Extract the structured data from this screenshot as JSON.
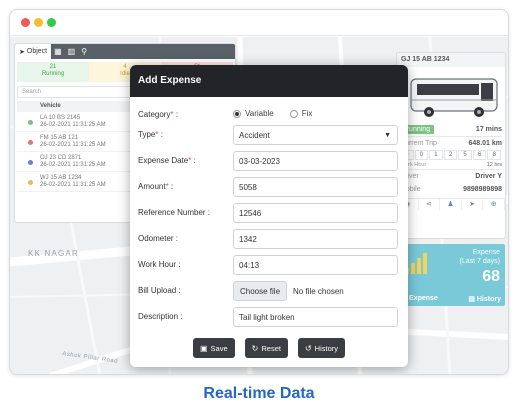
{
  "object_panel": {
    "tabs": {
      "object": "Object"
    },
    "status": [
      {
        "count": "21",
        "label": "Running"
      },
      {
        "count": "4",
        "label": "Idle"
      },
      {
        "count": "",
        "label": "St"
      }
    ],
    "search_placeholder": "Search",
    "column_vehicle": "Vehicle",
    "vehicles": [
      {
        "number": "LA 10 BS 2145",
        "time": "26-02-2021 11:31:25 AM",
        "color": "#7fbf7f"
      },
      {
        "number": "FM 15 AB 121",
        "time": "26-02-2021 11:31:25 AM",
        "color": "#e57373"
      },
      {
        "number": "OJ 23 CD 2871",
        "time": "26-02-2021 11:31:25 AM",
        "color": "#6a7fd6"
      },
      {
        "number": "WJ 15 AB 1234",
        "time": "26-02-2021 11:31:25 AM",
        "color": "#f0b85a"
      }
    ]
  },
  "map": {
    "area_label": "KK NAGAR",
    "road_label": "Ashok Pillar Road"
  },
  "vehicle_card": {
    "title": "GJ 15 AB 1234",
    "status": "Running",
    "duration": "17 mins",
    "current_trip_label": "Current Trip",
    "current_trip_value": "648.01 km",
    "odometer_digits": [
      "0",
      "0",
      "1",
      "2",
      "5",
      "6",
      "8"
    ],
    "work_hour_label": "Work Hour",
    "work_hour_value": "12 hrs",
    "driver_label": "Driver",
    "driver_value": "Driver Y",
    "mobile_label": "Mobile",
    "mobile_value": "9898989898"
  },
  "expense_widget": {
    "title_line1": "Expense",
    "title_line2": "(Last 7 days)",
    "count": "68",
    "add_label": "+ Expense",
    "history_label": "History",
    "bar_color": "#f4d35e"
  },
  "modal": {
    "title": "Add Expense",
    "category_label": "Category",
    "category_options": [
      "Variable",
      "Fix"
    ],
    "category_selected": "Variable",
    "type_label": "Type",
    "type_value": "Accident",
    "expense_date_label": "Expense Date",
    "expense_date_value": "03-03-2023",
    "amount_label": "Amount",
    "amount_value": "5058",
    "reference_label": "Reference Number :",
    "reference_value": "12546",
    "odometer_label": "Odometer :",
    "odometer_value": "1342",
    "work_hour_label": "Work Hour :",
    "work_hour_value": "04:13",
    "bill_upload_label": "Bill Upload :",
    "choose_file_label": "Choose file",
    "no_file_text": "No file chosen",
    "description_label": "Description :",
    "description_value": "Tail light broken",
    "buttons": {
      "save": "Save",
      "reset": "Reset",
      "history": "History"
    }
  },
  "caption": "Real-time Data",
  "colors": {
    "accent": "#2566c8",
    "header_dark": "#222428",
    "running_green": "#7ec382",
    "widget_teal": "#79c9d9"
  }
}
